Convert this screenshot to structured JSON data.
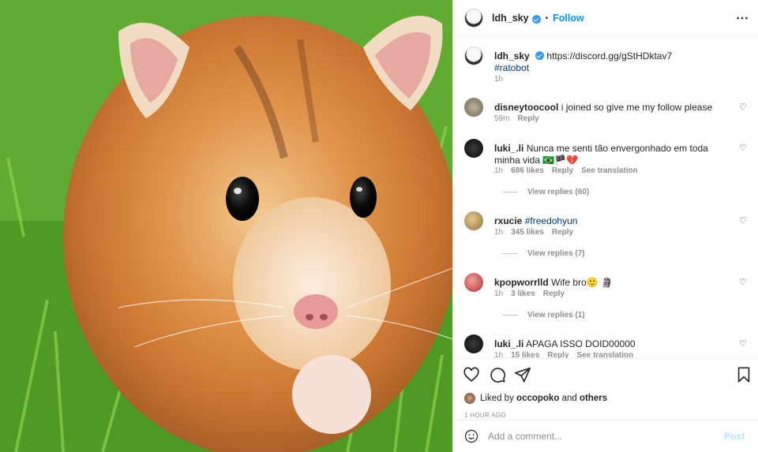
{
  "post": {
    "username": "ldh_sky",
    "follow_label": "Follow",
    "caption_link": "https://discord.gg/gStHDktav7",
    "caption_tag": "#ratobot",
    "caption_time": "1h"
  },
  "comments": [
    {
      "user": "disneytoocool",
      "text": "i joined so give me my follow please",
      "time": "59m",
      "likes": "",
      "reply": "Reply",
      "translate": "",
      "view_replies": ""
    },
    {
      "user": "luki_.li",
      "text": "Nunca me senti tão envergonhado em toda minha vida 🇧🇷🏴💔",
      "time": "1h",
      "likes": "686 likes",
      "reply": "Reply",
      "translate": "See translation",
      "view_replies": "View replies (60)"
    },
    {
      "user": "rxucie",
      "text": "#freedohyun",
      "time": "1h",
      "likes": "345 likes",
      "reply": "Reply",
      "translate": "",
      "view_replies": "View replies (7)"
    },
    {
      "user": "kpopworrlld",
      "text": "Wife bro🙂 🗿",
      "time": "1h",
      "likes": "3 likes",
      "reply": "Reply",
      "translate": "",
      "view_replies": "View replies (1)"
    },
    {
      "user": "luki_.li",
      "text": "APAGA ISSO DOID00000",
      "time": "1h",
      "likes": "15 likes",
      "reply": "Reply",
      "translate": "See translation",
      "view_replies": ""
    }
  ],
  "footer": {
    "liked_prefix": "Liked by",
    "liked_user": "occopoko",
    "liked_and": "and",
    "liked_others": "others",
    "time_ago": "1 HOUR AGO",
    "comment_placeholder": "Add a comment...",
    "post_label": "Post"
  },
  "icons": [
    "more-icon",
    "verified-icon",
    "heart-icon",
    "comment-icon",
    "share-icon",
    "bookmark-icon",
    "emoji-icon"
  ],
  "colors": {
    "accent": "#0095f6",
    "hashtag": "#00376b",
    "muted": "#8e8e8e",
    "post_disabled": "#b2dffc"
  }
}
